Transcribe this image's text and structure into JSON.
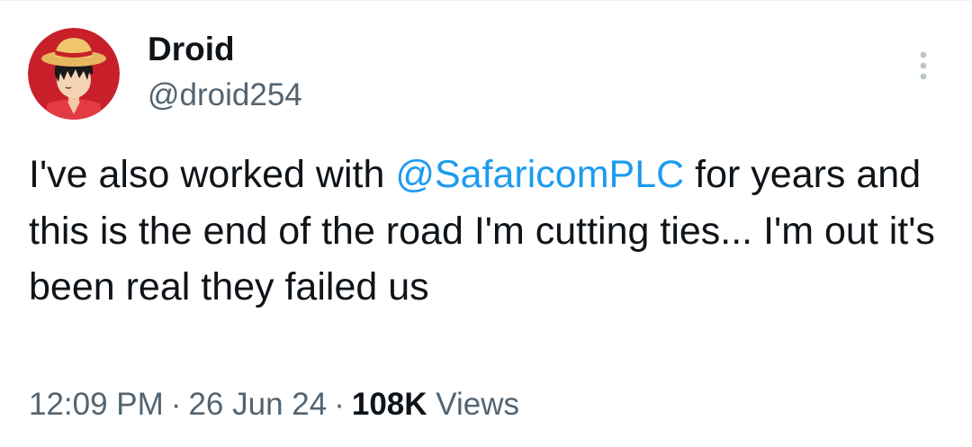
{
  "author": {
    "display_name": "Droid",
    "handle": "@droid254",
    "avatar_icon": "anime-avatar-straw-hat"
  },
  "more_menu_icon": "more-vertical-icon",
  "tweet": {
    "text_before_mention": "I've also worked with ",
    "mention": "@SafaricomPLC",
    "text_after_mention": " for years and this is the end of the road I'm cutting ties... I'm out it's been real they failed us"
  },
  "meta": {
    "time": "12:09 PM",
    "separator": "·",
    "date": "26 Jun 24",
    "views_count": "108K",
    "views_label": "Views"
  },
  "colors": {
    "text": "#0f1419",
    "secondary": "#536471",
    "link": "#1d9bf0",
    "avatar_bg": "#c8202a"
  }
}
